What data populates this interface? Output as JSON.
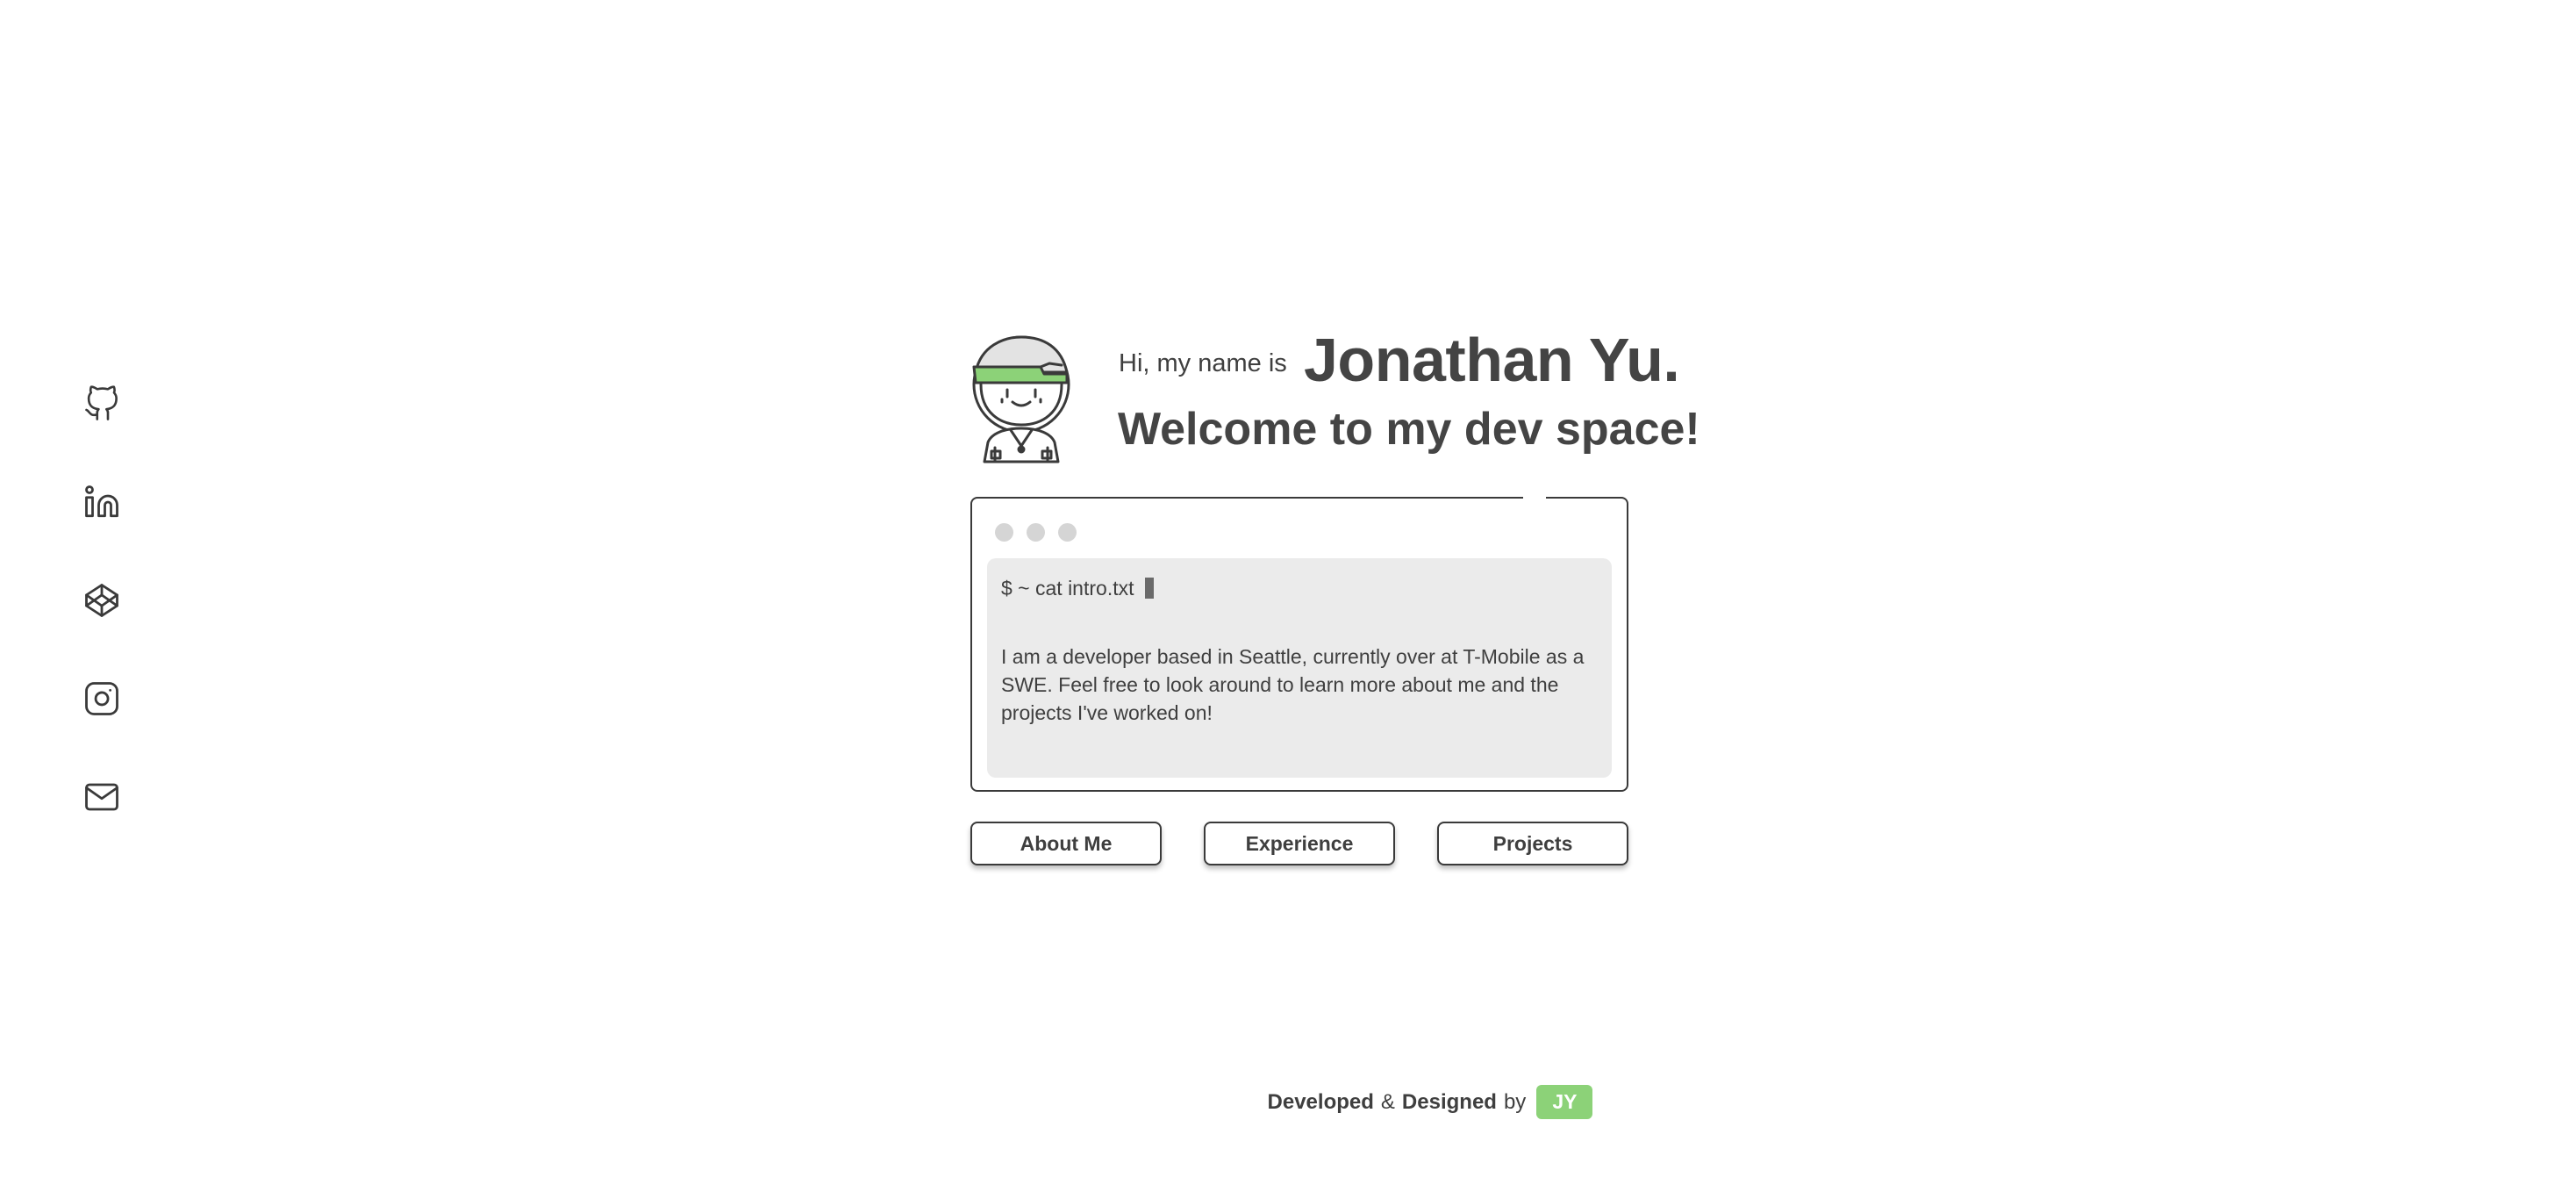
{
  "header": {
    "greeting": "Hi, my name is",
    "name": "Jonathan Yu.",
    "welcome": "Welcome to my dev space!"
  },
  "terminal": {
    "command": "$ ~ cat intro.txt",
    "intro": "I am a developer based in Seattle, currently over at T-Mobile as a SWE. Feel free to look around to learn more about me and the projects I've worked on!"
  },
  "nav": {
    "about": "About Me",
    "experience": "Experience",
    "projects": "Projects"
  },
  "social": {
    "icons": [
      "github-icon",
      "linkedin-icon",
      "codepen-icon",
      "instagram-icon",
      "mail-icon"
    ]
  },
  "footer": {
    "developed": "Developed",
    "amp": "&",
    "designed": "Designed",
    "by": "by",
    "badge": "JY"
  },
  "colors": {
    "accent": "#8cd278",
    "text": "#3f3f3f",
    "terminal_bg": "#ebebeb"
  }
}
